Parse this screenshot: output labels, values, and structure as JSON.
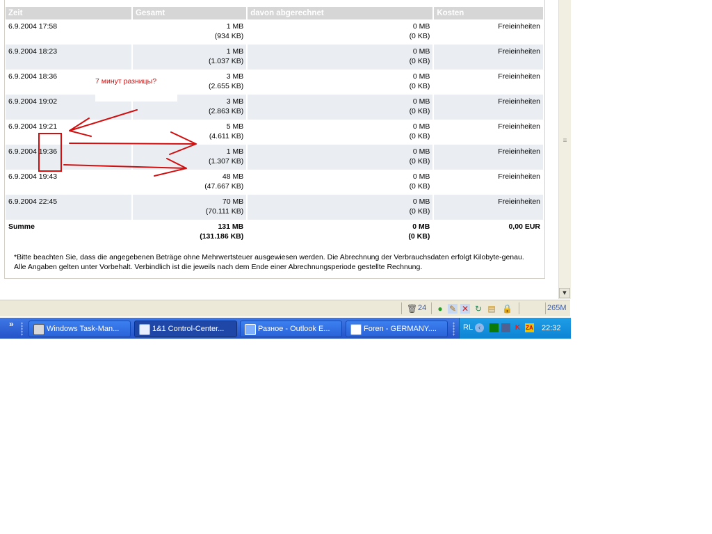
{
  "table": {
    "headers": [
      "Zeit",
      "Gesamt",
      "davon abgerechnet",
      "Kosten"
    ],
    "rows": [
      {
        "zeit": "6.9.2004 17:58",
        "gesamt_mb": "1 MB",
        "gesamt_kb": "(934 KB)",
        "abg_mb": "0 MB",
        "abg_kb": "(0 KB)",
        "kosten": "Freieinheiten"
      },
      {
        "zeit": "6.9.2004 18:23",
        "gesamt_mb": "1 MB",
        "gesamt_kb": "(1.037 KB)",
        "abg_mb": "0 MB",
        "abg_kb": "(0 KB)",
        "kosten": "Freieinheiten"
      },
      {
        "zeit": "6.9.2004 18:36",
        "gesamt_mb": "3 MB",
        "gesamt_kb": "(2.655 KB)",
        "abg_mb": "0 MB",
        "abg_kb": "(0 KB)",
        "kosten": "Freieinheiten"
      },
      {
        "zeit": "6.9.2004 19:02",
        "gesamt_mb": "3 MB",
        "gesamt_kb": "(2.863 KB)",
        "abg_mb": "0 MB",
        "abg_kb": "(0 KB)",
        "kosten": "Freieinheiten"
      },
      {
        "zeit": "6.9.2004 19:21",
        "gesamt_mb": "5 MB",
        "gesamt_kb": "(4.611 KB)",
        "abg_mb": "0 MB",
        "abg_kb": "(0 KB)",
        "kosten": "Freieinheiten"
      },
      {
        "zeit": "6.9.2004 19:36",
        "gesamt_mb": "1 MB",
        "gesamt_kb": "(1.307 KB)",
        "abg_mb": "0 MB",
        "abg_kb": "(0 KB)",
        "kosten": "Freieinheiten"
      },
      {
        "zeit": "6.9.2004 19:43",
        "gesamt_mb": "48 MB",
        "gesamt_kb": "(47.667 KB)",
        "abg_mb": "0 MB",
        "abg_kb": "(0 KB)",
        "kosten": "Freieinheiten"
      },
      {
        "zeit": "6.9.2004 22:45",
        "gesamt_mb": "70 MB",
        "gesamt_kb": "(70.111 KB)",
        "abg_mb": "0 MB",
        "abg_kb": "(0 KB)",
        "kosten": "Freieinheiten"
      }
    ],
    "sum": {
      "label": "Summe",
      "gesamt_mb": "131 MB",
      "gesamt_kb": "(131.186 KB)",
      "abg_mb": "0 MB",
      "abg_kb": "(0 KB)",
      "kosten": "0,00 EUR"
    }
  },
  "footnote": "*Bitte beachten Sie, dass die angegebenen Beträge ohne Mehrwertsteuer ausgewiesen werden. Die Abrechnung der Verbrauchsdaten erfolgt Kilobyte-genau. Alle Angaben gelten unter Vorbehalt. Verbindlich ist die jeweils nach dem Ende einer Abrechnungsperiode gestellte Rechnung.",
  "annotation": {
    "text": "7 минут разницы?",
    "color": "#d01010"
  },
  "statusbar": {
    "trash_count": "24",
    "memory": "265M"
  },
  "taskbar": {
    "buttons": [
      {
        "label": "Windows Task-Man...",
        "icon": "task-manager-icon"
      },
      {
        "label": "1&1 Control-Center...",
        "icon": "browser-page-icon",
        "active": true
      },
      {
        "label": "Разное - Outlook E...",
        "icon": "outlook-express-icon"
      },
      {
        "label": "Foren - GERMANY....",
        "icon": "web-page-icon"
      }
    ],
    "tray_text": "RL",
    "clock": "22:32"
  },
  "colors": {
    "header_bg": "#d6d6d6",
    "alt_row_bg": "#eaeef3",
    "taskbar": "#2a5fd6",
    "tray": "#148fdc",
    "annotation_red": "#d01010"
  }
}
